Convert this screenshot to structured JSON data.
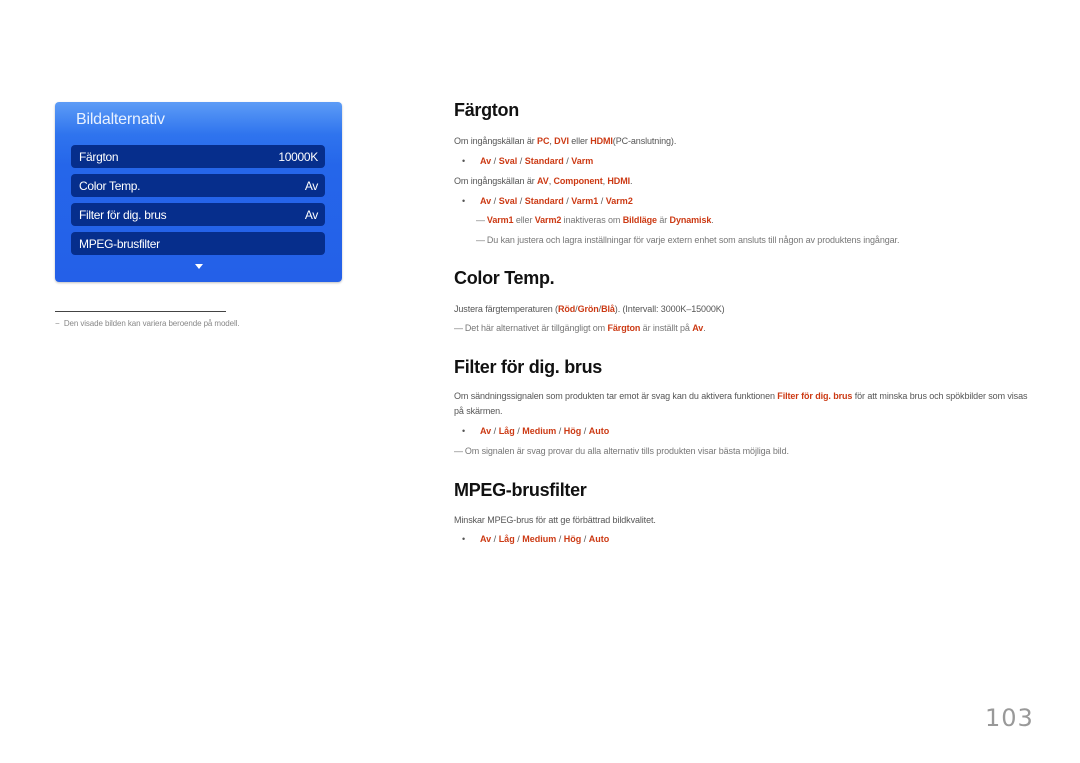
{
  "osd": {
    "title": "Bildalternativ",
    "items": [
      {
        "label": "Färgton",
        "value": "10000K"
      },
      {
        "label": "Color Temp.",
        "value": "Av"
      },
      {
        "label": "Filter för dig. brus",
        "value": "Av"
      },
      {
        "label": "MPEG-brusfilter",
        "value": ""
      }
    ],
    "scroll_icon": "triangle-down-icon"
  },
  "footnote": {
    "dash": "−",
    "text": "Den visade bilden kan variera beroende på modell."
  },
  "sections": {
    "fargton": {
      "heading": "Färgton",
      "p1": {
        "pre": "Om ingångskällan är ",
        "a": "PC",
        "s1": ", ",
        "b": "DVI",
        "s2": " eller ",
        "c": "HDMI",
        "post": "(PC-anslutning)."
      },
      "options1": [
        "Av",
        "Sval",
        "Standard",
        "Varm"
      ],
      "p2": {
        "pre": "Om ingångskällan är ",
        "a": "AV",
        "s1": ", ",
        "b": "Component",
        "s2": ", ",
        "c": "HDMI",
        "post": "."
      },
      "options2": [
        "Av",
        "Sval",
        "Standard",
        "Varm1",
        "Varm2"
      ],
      "note1": {
        "a": "Varm1",
        "t1": " eller ",
        "b": "Varm2",
        "t2": " inaktiveras om ",
        "c": "Bildläge",
        "t3": " är ",
        "d": "Dynamisk",
        "t4": "."
      },
      "note2": "Du kan justera och lagra inställningar för varje extern enhet som ansluts till någon av produktens ingångar."
    },
    "colortemp": {
      "heading": "Color Temp.",
      "p1": {
        "pre": "Justera färgtemperaturen (",
        "a": "Röd",
        "s1": "/",
        "b": "Grön",
        "s2": "/",
        "c": "Blå",
        "post": "). (Intervall: 3000K–15000K)"
      },
      "note1": {
        "t1": "Det här alternativet är tillgängligt om ",
        "a": "Färgton",
        "t2": " är inställt på ",
        "b": "Av",
        "t3": "."
      }
    },
    "filter": {
      "heading": "Filter för dig. brus",
      "p1": {
        "pre": "Om sändningssignalen som produkten tar emot är svag kan du aktivera funktionen ",
        "a": "Filter för dig. brus",
        "post": " för att minska brus och spökbilder som visas på skärmen."
      },
      "options": [
        "Av",
        "Låg",
        "Medium",
        "Hög",
        "Auto"
      ],
      "note1": "Om signalen är svag provar du alla alternativ tills produkten visar bästa möjliga bild."
    },
    "mpeg": {
      "heading": "MPEG-brusfilter",
      "p1": "Minskar MPEG-brus för att ge förbättrad bildkvalitet.",
      "options": [
        "Av",
        "Låg",
        "Medium",
        "Hög",
        "Auto"
      ]
    }
  },
  "bullet_glyph": "•",
  "note_glyph": "―",
  "separator": " / ",
  "page_number": "103",
  "colors": {
    "accent": "#cc3a14",
    "panel": "#2563e9",
    "panel_item": "#062e8c"
  }
}
